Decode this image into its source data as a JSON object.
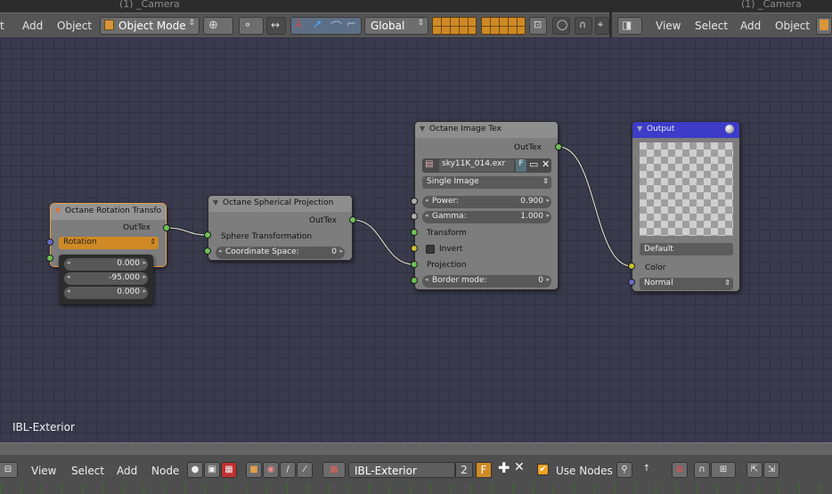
{
  "top_header": {
    "left": {
      "camera_label": "(1) _Camera",
      "menu": [
        "t",
        "Add",
        "Object"
      ],
      "mode": "Object Mode",
      "orientation": "Global"
    },
    "right": {
      "camera_label": "(1) _Camera",
      "menu": [
        "View",
        "Select",
        "Add",
        "Object"
      ]
    }
  },
  "node_editor": {
    "name": "IBL-Exterior",
    "nodes": {
      "rotation": {
        "title": "Octane Rotation Transfo",
        "output": "OutTex",
        "dropdown": "Rotation",
        "values": [
          "0.000",
          "-95.000",
          "0.000"
        ]
      },
      "spherical": {
        "title": "Octane Spherical Projection",
        "output": "OutTex",
        "input": "Sphere Transformation",
        "coord_label": "Coordinate Space:",
        "coord_value": "0"
      },
      "image": {
        "title": "Octane Image Tex",
        "output": "OutTex",
        "file": "sky11K_014.exr",
        "fake_user": "F",
        "mode": "Single Image",
        "power_label": "Power:",
        "power_value": "0.900",
        "gamma_label": "Gamma:",
        "gamma_value": "1.000",
        "transform": "Transform",
        "invert": "Invert",
        "projection": "Projection",
        "border_label": "Border mode:",
        "border_value": "0"
      },
      "output": {
        "title": "Output",
        "default": "Default",
        "color": "Color",
        "normal": "Normal"
      }
    }
  },
  "bottom_header": {
    "menu": [
      "View",
      "Select",
      "Add",
      "Node"
    ],
    "nodetree_name": "IBL-Exterior",
    "users": "2",
    "fake": "F",
    "use_nodes": "Use Nodes"
  },
  "colors": {
    "grid_bg": "#393a4c",
    "output_header": "#3c3cc8",
    "orange": "#d08a25"
  }
}
